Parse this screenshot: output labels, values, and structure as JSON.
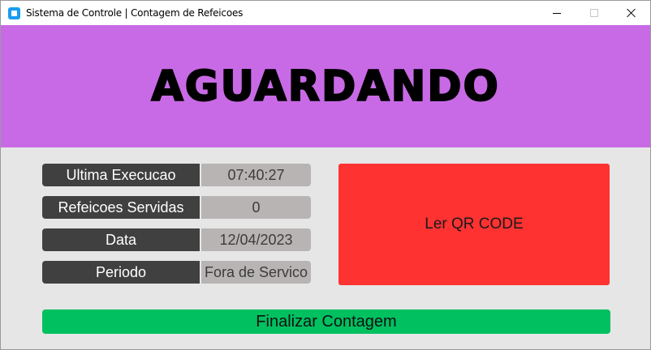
{
  "window": {
    "title": "Sistema de Controle | Contagem de Refeicoes"
  },
  "banner": {
    "status_text": "AGUARDANDO",
    "background_color": "#c86ae6"
  },
  "info_rows": [
    {
      "label": "Ultima Execucao",
      "value": "07:40:27"
    },
    {
      "label": "Refeicoes Servidas",
      "value": "0"
    },
    {
      "label": "Data",
      "value": "12/04/2023"
    },
    {
      "label": "Periodo",
      "value": "Fora de Servico"
    }
  ],
  "actions": {
    "read_qr_label": "Ler QR CODE",
    "read_qr_color": "#ff3232",
    "finish_label": "Finalizar Contagem",
    "finish_color": "#00c060"
  }
}
